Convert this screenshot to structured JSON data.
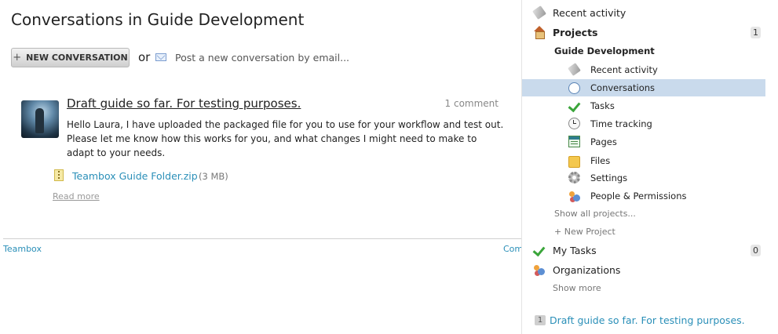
{
  "main": {
    "title": "Conversations in Guide Development",
    "new_conversation_button": "NEW CONVERSATION",
    "new_conversation_plus": "+",
    "or_text": "or",
    "email_link": "Post a new conversation by email...",
    "conversation": {
      "title": "Draft guide so far. For testing purposes.",
      "comment_count": "1 comment",
      "body": "Hello Laura, I have uploaded the packaged file for you to use for your workflow and test out. Please let me know how this works for you, and what changes I might need to make to adapt to your needs.",
      "attachment_name": "Teambox Guide Folder.zip",
      "attachment_size": "(3 MB)",
      "read_more": "Read more"
    },
    "footer": {
      "left_link": "Teambox",
      "right_link": "Com"
    }
  },
  "sidebar": {
    "recent_activity": "Recent activity",
    "projects": "Projects",
    "projects_count": "1",
    "project_name": "Guide Development",
    "project_items": [
      {
        "label": "Recent activity",
        "icon": "tag-icon"
      },
      {
        "label": "Conversations",
        "icon": "speech-bubble-icon",
        "selected": true
      },
      {
        "label": "Tasks",
        "icon": "checkmark-icon"
      },
      {
        "label": "Time tracking",
        "icon": "clock-icon"
      },
      {
        "label": "Pages",
        "icon": "pages-icon"
      },
      {
        "label": "Files",
        "icon": "folder-icon"
      },
      {
        "label": "Settings",
        "icon": "gear-icon"
      },
      {
        "label": "People & Permissions",
        "icon": "people-icon"
      }
    ],
    "show_all_projects": "Show all projects...",
    "new_project": "+ New Project",
    "my_tasks": "My Tasks",
    "my_tasks_count": "0",
    "organizations": "Organizations",
    "show_more": "Show more",
    "bottom_count": "1",
    "bottom_link": "Draft guide so far. For testing purposes."
  },
  "colors": {
    "link": "#2a8fb8",
    "selected_row": "#c9daec"
  }
}
